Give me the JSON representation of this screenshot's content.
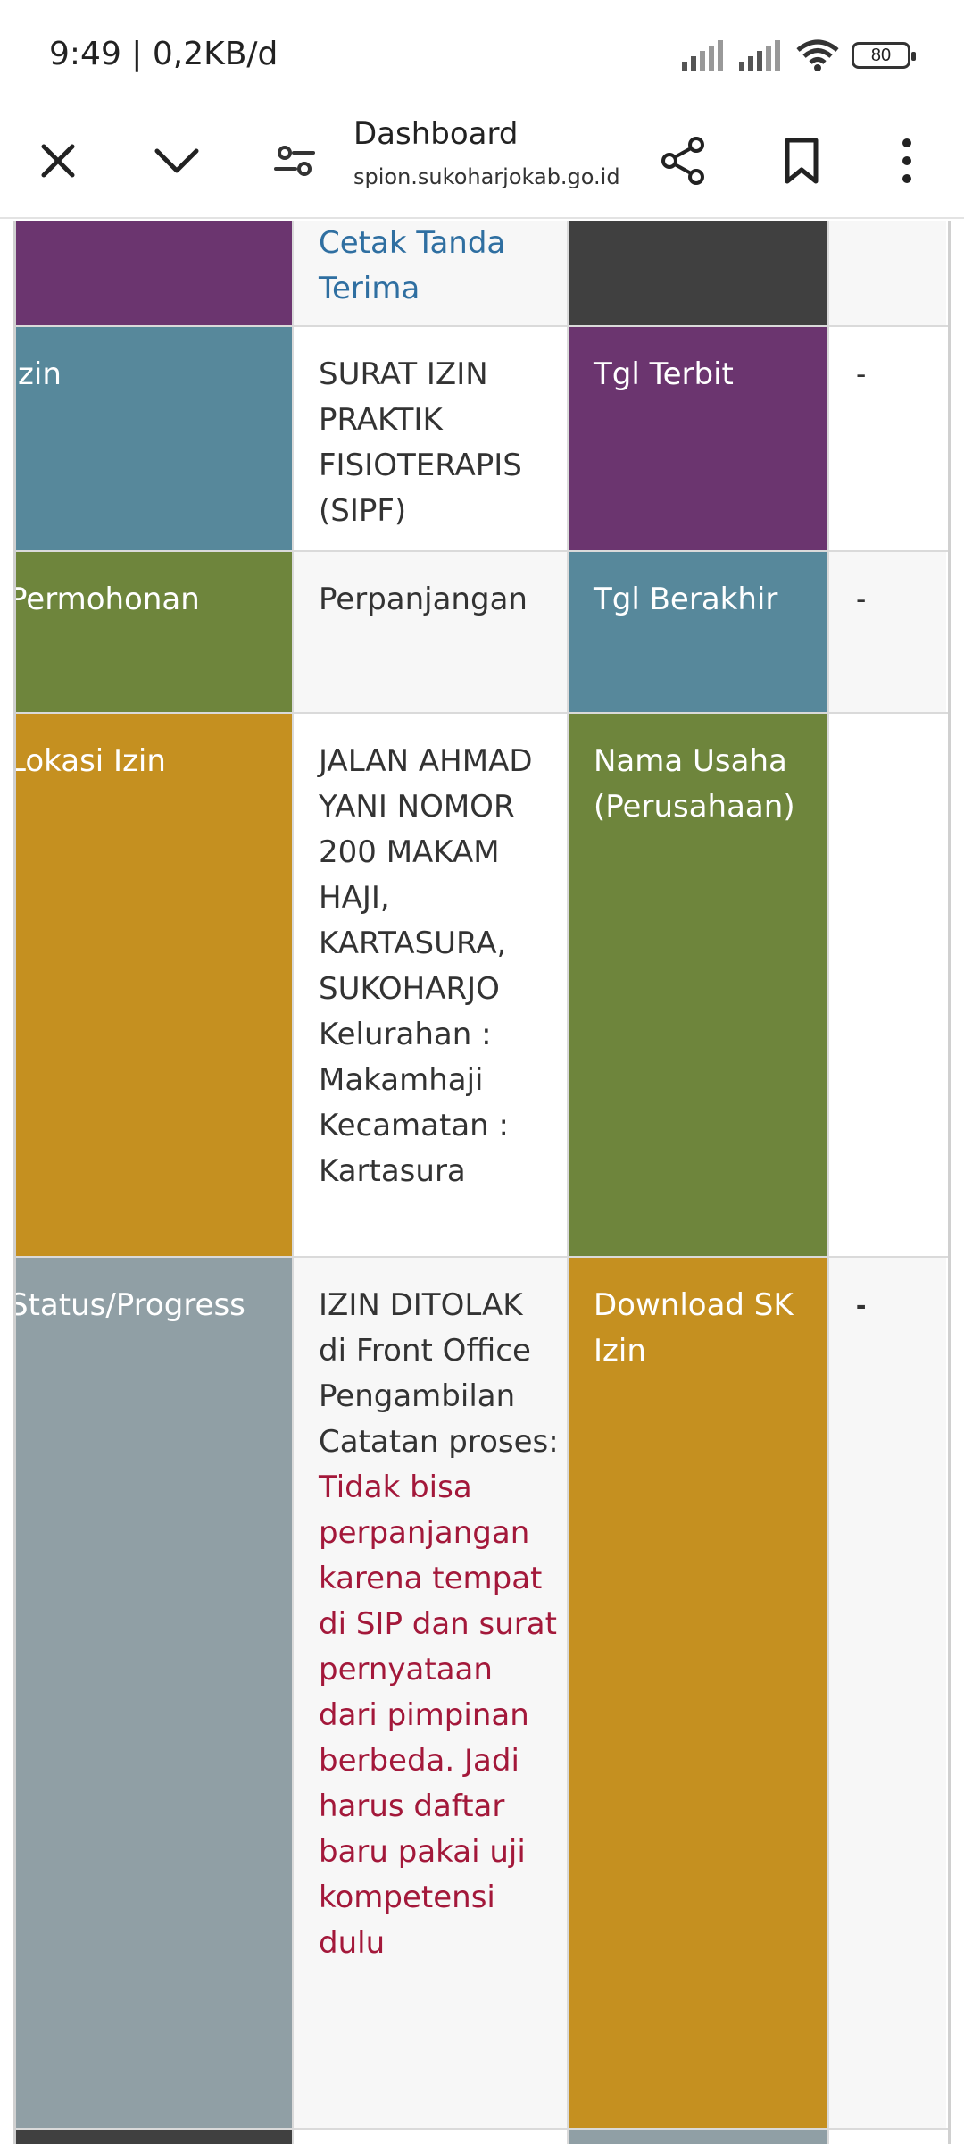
{
  "status_bar": {
    "time": "9:49 | 0,2KB/d",
    "battery": "80",
    "icons": [
      "signal-icon",
      "signal-icon",
      "wifi-icon",
      "battery-icon"
    ]
  },
  "browser": {
    "title": "Dashboard",
    "url": "spion.sukoharjokab.go.id",
    "icons": [
      "close-icon",
      "chevron-down-icon",
      "tune-icon",
      "share-icon",
      "bookmark-icon",
      "more-vert-icon"
    ]
  },
  "table": {
    "row0": {
      "value": "Cetak Tanda Terima"
    },
    "row1": {
      "label1": "Izin",
      "value": "SURAT IZIN PRAKTIK FISIOTERAPIS (SIPF)",
      "label2": "Tgl Terbit",
      "value2": "-"
    },
    "row2": {
      "label1": "Permohonan",
      "value": "Perpanjangan",
      "label2": "Tgl Berakhir",
      "value2": "-"
    },
    "row3": {
      "label1": "Lokasi Izin",
      "value": "JALAN AHMAD YANI NOMOR 200 MAKAM HAJI, KARTASURA, SUKOHARJO",
      "kelurahan": "Kelurahan : Makamhaji",
      "kecamatan": "Kecamatan : Kartasura",
      "label2": "Nama Usaha (Perusahaan)",
      "value2": ""
    },
    "row4": {
      "label1": "Status/Progress",
      "value": "IZIN DITOLAK di Front Office Pengambilan",
      "note_label": "Catatan proses:",
      "note": "Tidak bisa perpanjangan karena tempat di SIP dan surat pernyataan dari pimpinan berbeda. Jadi harus daftar baru pakai uji kompetensi dulu",
      "label2": "Download SK Izin",
      "value2": "-"
    }
  },
  "colors": {
    "purple": "#6b356f",
    "teal": "#57889b",
    "olive": "#6e853c",
    "gold": "#c59020",
    "grey": "#909fa5",
    "link": "#2f6fa1",
    "note": "#a3183a"
  }
}
